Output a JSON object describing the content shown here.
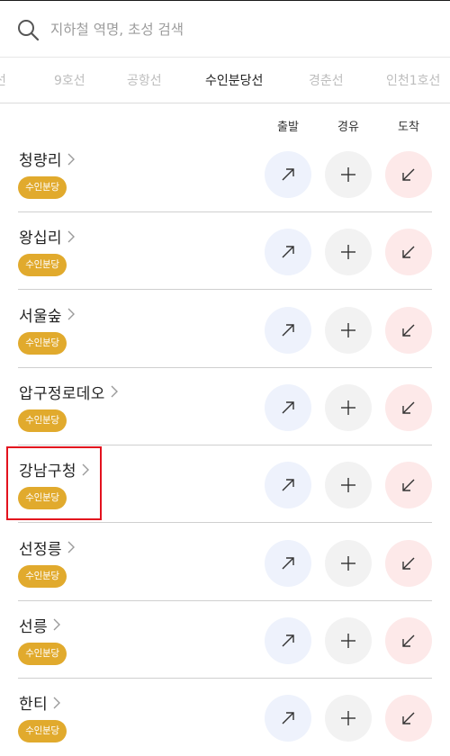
{
  "search": {
    "placeholder": "지하철 역명, 초성 검색",
    "value": ""
  },
  "tabs": [
    {
      "label": "선",
      "active": false
    },
    {
      "label": "9호선",
      "active": false
    },
    {
      "label": "공항선",
      "active": false
    },
    {
      "label": "수인분당선",
      "active": true
    },
    {
      "label": "경춘선",
      "active": false
    },
    {
      "label": "인천1호선",
      "active": false
    }
  ],
  "columns": {
    "departure": "출발",
    "via": "경유",
    "arrival": "도착"
  },
  "line_badge": "수인분당",
  "colors": {
    "badge": "#e1aa2d",
    "departure_bg": "#eef2fc",
    "via_bg": "#f2f2f2",
    "arrival_bg": "#fde9e9",
    "highlight": "#e3121e"
  },
  "stations": [
    {
      "name": "청량리"
    },
    {
      "name": "왕십리"
    },
    {
      "name": "서울숲"
    },
    {
      "name": "압구정로데오"
    },
    {
      "name": "강남구청"
    },
    {
      "name": "선정릉"
    },
    {
      "name": "선릉"
    },
    {
      "name": "한티"
    }
  ],
  "highlighted_station": "강남구청",
  "icons": {
    "search": "search-icon",
    "chevron": "chevron-right-icon",
    "departure": "arrow-up-right-icon",
    "via": "plus-icon",
    "arrival": "arrow-down-left-icon"
  }
}
